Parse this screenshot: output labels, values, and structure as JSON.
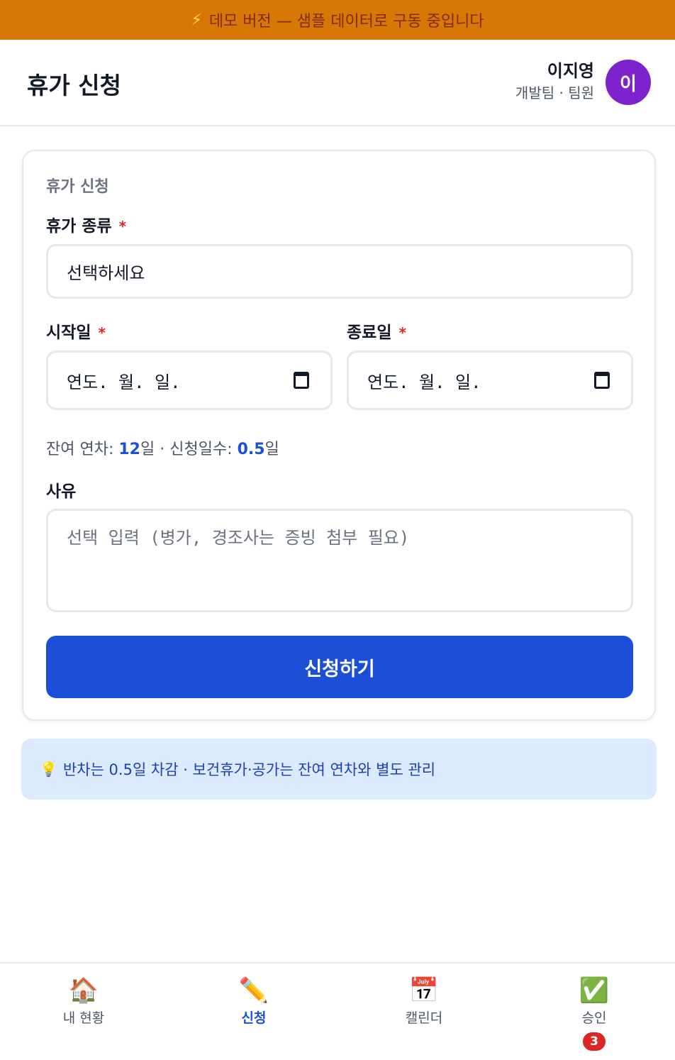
{
  "banner": {
    "icon": "lightning-icon",
    "text": "데모 버전 — 샘플 데이터로 구동 중입니다",
    "bolt": "⚡"
  },
  "header": {
    "title": "휴가 신청"
  },
  "user": {
    "name": "이지영",
    "meta": "개발팀 · 팀원",
    "avatar_initial": "이"
  },
  "form": {
    "card_title": "휴가 신청",
    "type_label": "휴가 종류",
    "type_value": "선택하세요",
    "start_label": "시작일",
    "end_label": "종료일",
    "date_placeholder": "연도. 월. 일.",
    "required_mark": "*",
    "balance_prefix": "잔여 연차: ",
    "balance_value": "12",
    "balance_unit": "일",
    "separator": " · ",
    "request_prefix": "신청일수: ",
    "request_value": "0.5",
    "request_unit": "일",
    "reason_label": "사유",
    "reason_placeholder": "선택 입력 (병가, 경조사는 증빙 첨부 필요)",
    "submit_label": "신청하기"
  },
  "tip": {
    "icon": "lightbulb-icon",
    "glyph": "💡",
    "text": "반차는 0.5일 차감 · 보건휴가·공가는 잔여 연차와 별도 관리"
  },
  "tabs": [
    {
      "label": "내 현황",
      "icon": "house-icon",
      "glyph": "🏠"
    },
    {
      "label": "신청",
      "icon": "pencil-icon",
      "glyph": "✏️"
    },
    {
      "label": "캘린더",
      "icon": "calendar-icon",
      "glyph": "📅"
    },
    {
      "label": "승인",
      "icon": "check-icon",
      "glyph": "✅",
      "badge": "3"
    }
  ],
  "colors": {
    "banner": "#d97706",
    "accent": "#1d4ed8",
    "avatar": "#7e22ce",
    "badge": "#dc2626",
    "tip_bg": "#dbeafe"
  }
}
